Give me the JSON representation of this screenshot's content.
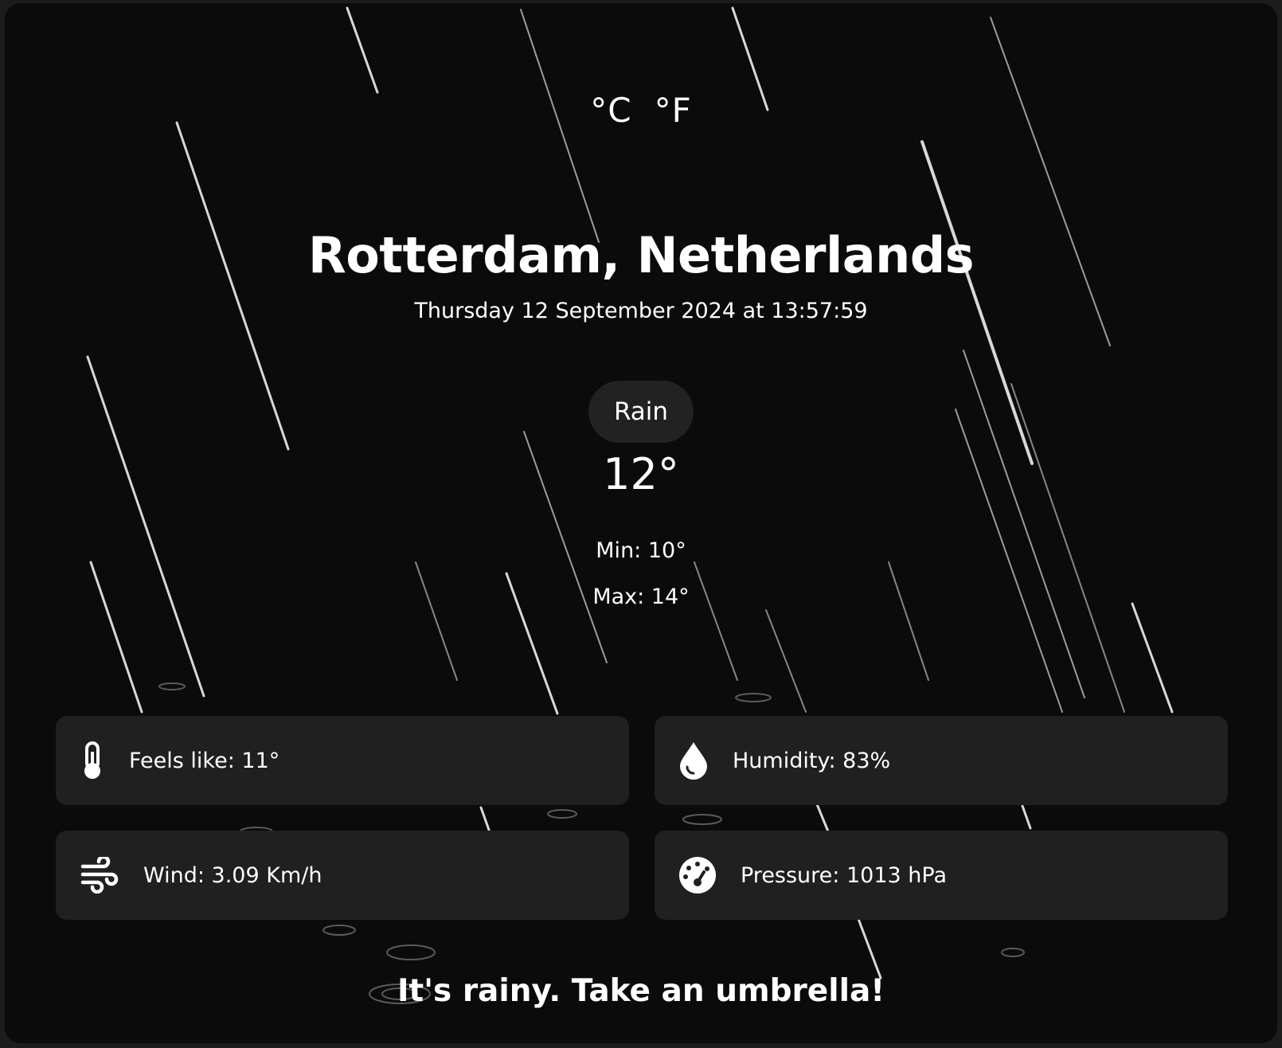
{
  "units": {
    "celsius": "°C",
    "fahrenheit": "°F"
  },
  "location": "Rotterdam, Netherlands",
  "datetime": "Thursday 12 September 2024 at 13:57:59",
  "condition": "Rain",
  "temperature": "12°",
  "min": "Min: 10°",
  "max": "Max: 14°",
  "details": {
    "feels_like": {
      "label": "Feels like: 11°",
      "icon": "thermometer-icon"
    },
    "humidity": {
      "label": "Humidity: 83%",
      "icon": "water-drop-icon"
    },
    "wind": {
      "label": "Wind: 3.09 Km/h",
      "icon": "wind-icon"
    },
    "pressure": {
      "label": "Pressure: 1013 hPa",
      "icon": "gauge-icon"
    }
  },
  "message": "It's rainy. Take an umbrella!",
  "colors": {
    "background": "#0b0b0b",
    "card": "#202020",
    "pill": "#222222",
    "text": "#ffffff"
  }
}
